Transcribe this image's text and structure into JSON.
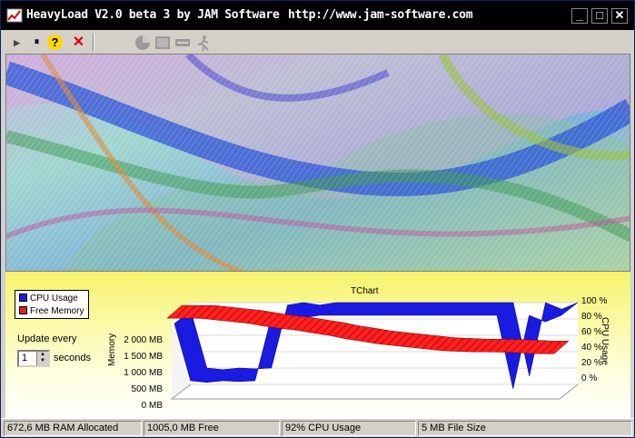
{
  "window": {
    "title": "HeavyLoad V2.0 beta 3 by JAM Software",
    "url": "http://www.jam-software.com",
    "controls": [
      "_",
      "□",
      "✕"
    ]
  },
  "toolbar": {
    "play": "▸",
    "pause": "⏸",
    "help": "?",
    "stop": "✕"
  },
  "chart": {
    "title": "TChart",
    "legend": [
      {
        "label": "CPU Usage",
        "color": "#1a1ae0"
      },
      {
        "label": "Free Memory",
        "color": "#e02020"
      }
    ],
    "left_axis_label": "Memory",
    "right_axis_label": "CPU Usage",
    "left_ticks": [
      "2 000 MB",
      "1 500 MB",
      "1 000 MB",
      "500 MB",
      "0 MB"
    ],
    "right_ticks": [
      "100 %",
      "80 %",
      "60 %",
      "40 %",
      "20 %",
      "0 %"
    ]
  },
  "chart_data": {
    "type": "area",
    "title": "TChart",
    "series": [
      {
        "name": "CPU Usage",
        "values": [
          90,
          20,
          18,
          20,
          19,
          20,
          97,
          100,
          97,
          100,
          100,
          100,
          100,
          100,
          100,
          100,
          100,
          100,
          100,
          100,
          100,
          10,
          100,
          92,
          100
        ]
      },
      {
        "name": "Free Memory",
        "values": [
          2050,
          2050,
          2050,
          2000,
          1950,
          1900,
          1820,
          1750,
          1700,
          1620,
          1550,
          1450,
          1380,
          1300,
          1250,
          1200,
          1150,
          1100,
          1080,
          1060,
          1060,
          1050,
          1030,
          1005,
          1005
        ]
      }
    ],
    "ylim_left": [
      0,
      2000
    ],
    "ylim_right": [
      0,
      100
    ]
  },
  "update": {
    "label": "Update every",
    "value": "1",
    "unit": "seconds"
  },
  "statusbar": {
    "ram_allocated": "672,6 MB RAM Allocated",
    "free": "1005,0 MB Free",
    "cpu": "92% CPU Usage",
    "file_size": "5 MB File Size"
  }
}
